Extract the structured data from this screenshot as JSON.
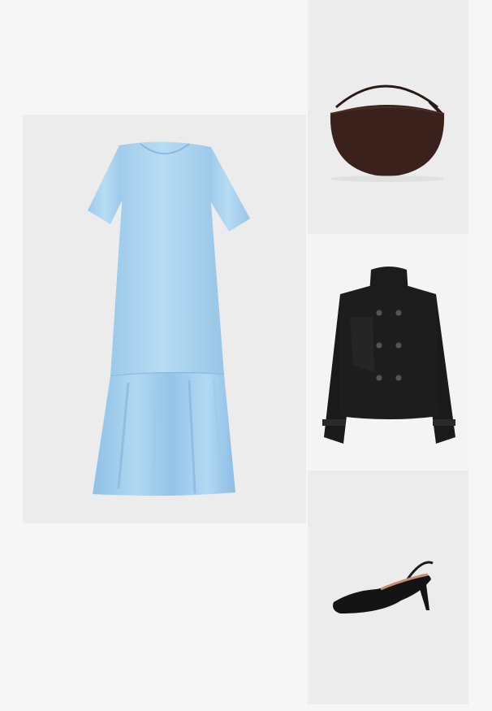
{
  "collage": {
    "background_color": "#f6f6f6",
    "items": [
      {
        "kind": "dress",
        "color": "#a9d2ef"
      },
      {
        "kind": "bag",
        "color": "#3a211b"
      },
      {
        "kind": "jacket",
        "color": "#1a1a1a"
      },
      {
        "kind": "shoe",
        "color": "#141414"
      }
    ]
  }
}
